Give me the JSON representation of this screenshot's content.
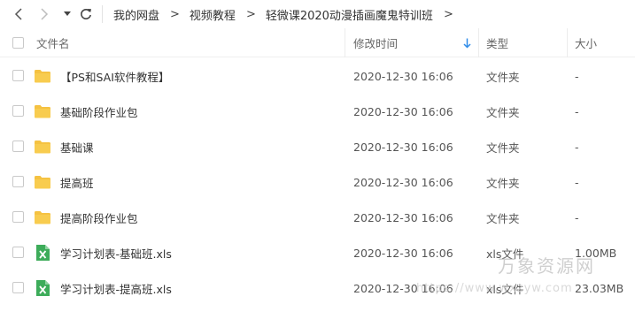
{
  "breadcrumb": {
    "items": [
      "我的网盘",
      "视频教程",
      "轻微课2020动漫插画魔鬼特训班"
    ],
    "separator": ">"
  },
  "header": {
    "name": "文件名",
    "modified": "修改时间",
    "type": "类型",
    "size": "大小"
  },
  "files": [
    {
      "name": "【PS和SAI软件教程】",
      "modified": "2020-12-30 16:06",
      "type": "文件夹",
      "size": "-",
      "icon": "folder-icon"
    },
    {
      "name": "基础阶段作业包",
      "modified": "2020-12-30 16:06",
      "type": "文件夹",
      "size": "-",
      "icon": "folder-icon"
    },
    {
      "name": "基础课",
      "modified": "2020-12-30 16:06",
      "type": "文件夹",
      "size": "-",
      "icon": "folder-icon"
    },
    {
      "name": "提高班",
      "modified": "2020-12-30 16:06",
      "type": "文件夹",
      "size": "-",
      "icon": "folder-icon"
    },
    {
      "name": "提高阶段作业包",
      "modified": "2020-12-30 16:06",
      "type": "文件夹",
      "size": "-",
      "icon": "folder-icon"
    },
    {
      "name": "学习计划表-基础班.xls",
      "modified": "2020-12-30 16:06",
      "type": "xls文件",
      "size": "1.00MB",
      "icon": "excel-file-icon"
    },
    {
      "name": "学习计划表-提高班.xls",
      "modified": "2020-12-30 16:06",
      "type": "xls文件",
      "size": "23.03MB",
      "icon": "excel-file-icon"
    }
  ],
  "watermark": {
    "text": "万象资源网",
    "url": "https://www.wxzyw.com"
  },
  "colors": {
    "folder": "#f5c242",
    "excel": "#3dac5a",
    "sort_arrow": "#2f8ce8"
  }
}
